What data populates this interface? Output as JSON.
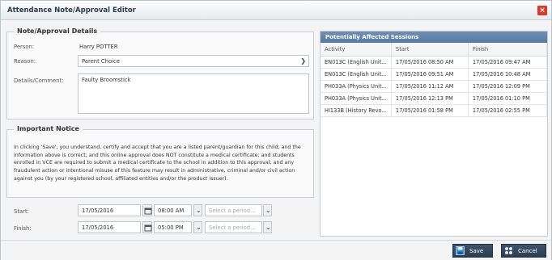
{
  "window": {
    "title": "Attendance Note/Approval Editor"
  },
  "note": {
    "legend": "Note/Approval Details",
    "person_label": "Person:",
    "person_value": "Harry POTTER",
    "reason_label": "Reason:",
    "reason_value": "Parent Choice",
    "details_label": "Details/Comment:",
    "details_value": "Faulty Broomstick"
  },
  "notice": {
    "legend": "Important Notice",
    "text": "In clicking 'Save', you understand, certify and accept that you are a listed parent/guardian for this child; and the information above is correct; and this online approval does NOT constitute a medical certificate; and students enrolled in VCE are required to submit a medical certificate to the school in addition to this approval; and any fraudulent action or intentional misuse of this feature may result in administrative, criminal and/or civil action against you (by your registered school, affiliated entities and/or the product issuer)."
  },
  "start": {
    "label": "Start:",
    "date": "17/05/2016",
    "time": "08:00 AM",
    "period_placeholder": "Select a period..."
  },
  "finish": {
    "label": "Finish:",
    "date": "17/05/2016",
    "time": "05:00 PM",
    "period_placeholder": "Select a period..."
  },
  "sessions": {
    "title": "Potentially Affected Sessions",
    "columns": [
      "Activity",
      "Start",
      "Finish"
    ],
    "rows": [
      [
        "EN013C (English Unit...",
        "17/05/2016 08:50 AM",
        "17/05/2016 09:47 AM"
      ],
      [
        "EN013C (English Unit...",
        "17/05/2016 09:51 AM",
        "17/05/2016 10:48 AM"
      ],
      [
        "PH033A (Physics Unit...",
        "17/05/2016 11:12 AM",
        "17/05/2016 12:09 PM"
      ],
      [
        "PH033A (Physics Unit...",
        "17/05/2016 12:13 PM",
        "17/05/2016 01:10 PM"
      ],
      [
        "HI133B (History Revo...",
        "17/05/2016 01:58 PM",
        "17/05/2016 02:55 PM"
      ]
    ]
  },
  "buttons": {
    "save": "Save",
    "cancel": "Cancel"
  },
  "colors": {
    "close": "#d83b2e",
    "panel_header": "#587aa2",
    "button": "#2c3d52"
  },
  "icons": {
    "close": "close-icon",
    "calendar": "calendar-icon",
    "dropdown": "chevron-down-icon",
    "save": "save-icon",
    "cancel": "cancel-icon"
  }
}
